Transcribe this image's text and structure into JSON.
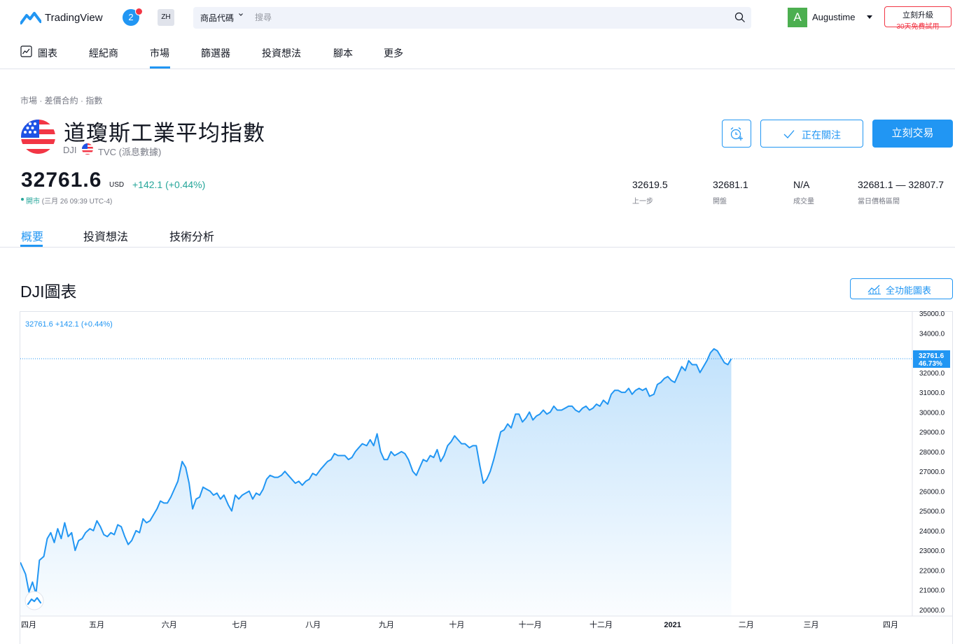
{
  "header": {
    "logo_text": "TradingView",
    "notification_count": "2",
    "language": "ZH",
    "search_category": "商品代碼",
    "search_placeholder": "搜尋",
    "user_initial": "A",
    "username": "Augustime",
    "upgrade_line1": "立刻升級",
    "upgrade_line2": "30天免費試用"
  },
  "nav": {
    "items": [
      "圖表",
      "經紀商",
      "市場",
      "篩選器",
      "投資想法",
      "腳本",
      "更多"
    ],
    "active": "市場"
  },
  "symbol": {
    "breadcrumb": "市場 · 差價合約 · 指數",
    "title": "道瓊斯工業平均指數",
    "ticker": "DJI",
    "exchange": "TVC (派息數據)",
    "price": "32761.6",
    "currency": "USD",
    "change": "+142.1 (+0.44%)",
    "market_open": "開市",
    "market_time": "(三月 26 09:39 UTC-4)",
    "follow_label": "正在關注",
    "trade_label": "立刻交易",
    "stats": [
      {
        "value": "32619.5",
        "label": "上一步"
      },
      {
        "value": "32681.1",
        "label": "開盤"
      },
      {
        "value": "N/A",
        "label": "成交量"
      },
      {
        "value": "32681.1 — 32807.7",
        "label": "當日價格區間"
      }
    ]
  },
  "tabs": [
    "概要",
    "投資想法",
    "技術分析"
  ],
  "chart_section": {
    "heading": "DJI圖表",
    "full_chart_label": "全功能圖表",
    "legend": "32761.6 +142.1 (+0.44%)"
  },
  "colors": {
    "accent": "#2196f3",
    "positive": "#26a69a",
    "negative": "#f23645"
  },
  "chart_data": {
    "type": "area",
    "title": "",
    "xlabel": "",
    "ylabel": "",
    "ylim": [
      20000,
      35000
    ],
    "yticks": [
      "35000.0",
      "34000.0",
      "33000.0",
      "32000.0",
      "31000.0",
      "30000.0",
      "29000.0",
      "28000.0",
      "27000.0",
      "26000.0",
      "25000.0",
      "24000.0",
      "23000.0",
      "22000.0",
      "21000.0",
      "20000.0"
    ],
    "xticks": [
      {
        "label": "四月",
        "t": 0
      },
      {
        "label": "五月",
        "t": 0.0878
      },
      {
        "label": "六月",
        "t": 0.1712
      },
      {
        "label": "七月",
        "t": 0.252
      },
      {
        "label": "八月",
        "t": 0.3364
      },
      {
        "label": "九月",
        "t": 0.4207
      },
      {
        "label": "十月",
        "t": 0.5015
      },
      {
        "label": "十一月",
        "t": 0.5858
      },
      {
        "label": "十二月",
        "t": 0.6673
      },
      {
        "label": "2021",
        "t": 0.7495,
        "bold": true
      },
      {
        "label": "二月",
        "t": 0.8341
      },
      {
        "label": "三月",
        "t": 0.9087
      },
      {
        "label": "四月",
        "t": 1.0
      }
    ],
    "last_value": "32761.6",
    "last_change_pct": "46.73%",
    "series": [
      {
        "points": [
          [
            0.0,
            22400
          ],
          [
            0.006,
            21800
          ],
          [
            0.01,
            20900
          ],
          [
            0.014,
            21400
          ],
          [
            0.018,
            20800
          ],
          [
            0.022,
            22500
          ],
          [
            0.027,
            22700
          ],
          [
            0.031,
            23600
          ],
          [
            0.035,
            23900
          ],
          [
            0.039,
            23400
          ],
          [
            0.043,
            24100
          ],
          [
            0.047,
            23600
          ],
          [
            0.051,
            24400
          ],
          [
            0.055,
            23700
          ],
          [
            0.059,
            23900
          ],
          [
            0.063,
            23000
          ],
          [
            0.067,
            23500
          ],
          [
            0.071,
            23600
          ],
          [
            0.075,
            23900
          ],
          [
            0.08,
            24100
          ],
          [
            0.084,
            24000
          ],
          [
            0.088,
            24500
          ],
          [
            0.092,
            24200
          ],
          [
            0.096,
            23800
          ],
          [
            0.1,
            23700
          ],
          [
            0.104,
            23900
          ],
          [
            0.108,
            23800
          ],
          [
            0.112,
            24300
          ],
          [
            0.116,
            24200
          ],
          [
            0.12,
            23700
          ],
          [
            0.124,
            23300
          ],
          [
            0.128,
            23500
          ],
          [
            0.133,
            24000
          ],
          [
            0.137,
            23900
          ],
          [
            0.141,
            24600
          ],
          [
            0.145,
            24400
          ],
          [
            0.149,
            24500
          ],
          [
            0.153,
            24800
          ],
          [
            0.157,
            25100
          ],
          [
            0.161,
            25500
          ],
          [
            0.165,
            25400
          ],
          [
            0.169,
            25400
          ],
          [
            0.173,
            25700
          ],
          [
            0.177,
            26100
          ],
          [
            0.181,
            26500
          ],
          [
            0.186,
            27500
          ],
          [
            0.19,
            27200
          ],
          [
            0.194,
            26400
          ],
          [
            0.198,
            25100
          ],
          [
            0.202,
            25600
          ],
          [
            0.206,
            25700
          ],
          [
            0.21,
            26200
          ],
          [
            0.214,
            26100
          ],
          [
            0.218,
            26000
          ],
          [
            0.222,
            25800
          ],
          [
            0.226,
            25900
          ],
          [
            0.23,
            25600
          ],
          [
            0.234,
            25800
          ],
          [
            0.239,
            25300
          ],
          [
            0.243,
            25000
          ],
          [
            0.247,
            25800
          ],
          [
            0.251,
            25600
          ],
          [
            0.255,
            25800
          ],
          [
            0.259,
            25900
          ],
          [
            0.263,
            26000
          ],
          [
            0.267,
            25600
          ],
          [
            0.271,
            25900
          ],
          [
            0.275,
            25800
          ],
          [
            0.279,
            26100
          ],
          [
            0.283,
            26600
          ],
          [
            0.287,
            26800
          ],
          [
            0.292,
            26700
          ],
          [
            0.296,
            26700
          ],
          [
            0.3,
            26800
          ],
          [
            0.304,
            27000
          ],
          [
            0.308,
            26800
          ],
          [
            0.312,
            26600
          ],
          [
            0.316,
            26400
          ],
          [
            0.32,
            26500
          ],
          [
            0.324,
            26300
          ],
          [
            0.328,
            26500
          ],
          [
            0.332,
            26600
          ],
          [
            0.336,
            26900
          ],
          [
            0.34,
            26800
          ],
          [
            0.345,
            27100
          ],
          [
            0.349,
            27300
          ],
          [
            0.353,
            27500
          ],
          [
            0.357,
            27600
          ],
          [
            0.361,
            27900
          ],
          [
            0.365,
            27800
          ],
          [
            0.369,
            27800
          ],
          [
            0.373,
            27800
          ],
          [
            0.377,
            27600
          ],
          [
            0.381,
            27700
          ],
          [
            0.385,
            28000
          ],
          [
            0.389,
            28200
          ],
          [
            0.393,
            28400
          ],
          [
            0.398,
            28300
          ],
          [
            0.402,
            28600
          ],
          [
            0.406,
            28300
          ],
          [
            0.41,
            28900
          ],
          [
            0.414,
            28000
          ],
          [
            0.418,
            27600
          ],
          [
            0.422,
            27600
          ],
          [
            0.426,
            28000
          ],
          [
            0.43,
            27800
          ],
          [
            0.434,
            27900
          ],
          [
            0.438,
            28000
          ],
          [
            0.442,
            27900
          ],
          [
            0.446,
            27600
          ],
          [
            0.451,
            27000
          ],
          [
            0.455,
            26800
          ],
          [
            0.459,
            27200
          ],
          [
            0.463,
            27600
          ],
          [
            0.467,
            27500
          ],
          [
            0.471,
            27800
          ],
          [
            0.475,
            27700
          ],
          [
            0.479,
            28100
          ],
          [
            0.483,
            27500
          ],
          [
            0.487,
            27800
          ],
          [
            0.491,
            28300
          ],
          [
            0.495,
            28500
          ],
          [
            0.499,
            28800
          ],
          [
            0.503,
            28600
          ],
          [
            0.507,
            28400
          ],
          [
            0.511,
            28400
          ],
          [
            0.516,
            28200
          ],
          [
            0.52,
            28300
          ],
          [
            0.524,
            28300
          ],
          [
            0.528,
            27300
          ],
          [
            0.532,
            26400
          ],
          [
            0.536,
            26600
          ],
          [
            0.54,
            27000
          ],
          [
            0.544,
            27600
          ],
          [
            0.548,
            28300
          ],
          [
            0.552,
            29000
          ],
          [
            0.556,
            29100
          ],
          [
            0.56,
            29400
          ],
          [
            0.564,
            29200
          ],
          [
            0.569,
            29900
          ],
          [
            0.573,
            29900
          ],
          [
            0.577,
            29500
          ],
          [
            0.581,
            29700
          ],
          [
            0.585,
            30000
          ],
          [
            0.589,
            29600
          ],
          [
            0.593,
            29800
          ],
          [
            0.597,
            29900
          ],
          [
            0.601,
            30100
          ],
          [
            0.605,
            29900
          ],
          [
            0.609,
            30000
          ],
          [
            0.613,
            30300
          ],
          [
            0.617,
            30100
          ],
          [
            0.622,
            30100
          ],
          [
            0.626,
            30200
          ],
          [
            0.63,
            30300
          ],
          [
            0.634,
            30300
          ],
          [
            0.638,
            30100
          ],
          [
            0.642,
            30000
          ],
          [
            0.646,
            30200
          ],
          [
            0.65,
            30300
          ],
          [
            0.654,
            30100
          ],
          [
            0.658,
            30200
          ],
          [
            0.662,
            30400
          ],
          [
            0.666,
            30300
          ],
          [
            0.67,
            30600
          ],
          [
            0.675,
            30400
          ],
          [
            0.679,
            30900
          ],
          [
            0.683,
            31100
          ],
          [
            0.687,
            31100
          ],
          [
            0.691,
            31000
          ],
          [
            0.695,
            31000
          ],
          [
            0.699,
            31200
          ],
          [
            0.703,
            30900
          ],
          [
            0.707,
            31100
          ],
          [
            0.711,
            31200
          ],
          [
            0.715,
            31100
          ],
          [
            0.719,
            31200
          ],
          [
            0.723,
            30800
          ],
          [
            0.728,
            30900
          ],
          [
            0.732,
            31400
          ],
          [
            0.736,
            31500
          ],
          [
            0.74,
            31700
          ],
          [
            0.744,
            31800
          ],
          [
            0.748,
            31600
          ],
          [
            0.752,
            31500
          ],
          [
            0.756,
            31900
          ],
          [
            0.76,
            32300
          ],
          [
            0.764,
            32100
          ],
          [
            0.768,
            32600
          ],
          [
            0.772,
            32400
          ],
          [
            0.777,
            32400
          ],
          [
            0.781,
            32000
          ],
          [
            0.785,
            32300
          ],
          [
            0.789,
            32600
          ],
          [
            0.793,
            33000
          ],
          [
            0.797,
            33200
          ],
          [
            0.801,
            33100
          ],
          [
            0.805,
            32800
          ],
          [
            0.809,
            32500
          ],
          [
            0.813,
            32400
          ],
          [
            0.817,
            32700
          ]
        ]
      }
    ]
  }
}
